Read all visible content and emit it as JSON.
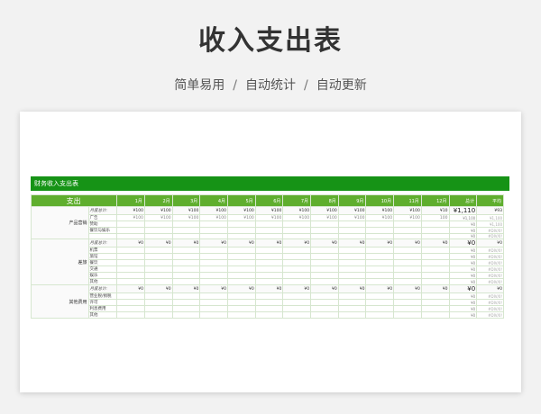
{
  "title": "收入支出表",
  "subtitle": [
    "简单易用",
    "自动统计",
    "自动更新"
  ],
  "separator": "/",
  "sheet": {
    "banner": "财务收入支出表",
    "header": {
      "main": "支出",
      "months": [
        "1月",
        "2月",
        "3月",
        "4月",
        "5月",
        "6月",
        "7月",
        "8月",
        "9月",
        "10月",
        "11月",
        "12月"
      ],
      "total": "总计",
      "avg": "平均"
    },
    "groups": [
      {
        "name": "产品营销",
        "summary": {
          "label": "月度总计:",
          "months": [
            "¥100",
            "¥100",
            "¥100",
            "¥100",
            "¥100",
            "¥100",
            "¥100",
            "¥100",
            "¥100",
            "¥100",
            "¥100",
            "¥10"
          ],
          "total": "¥1,110",
          "avg": "¥93"
        },
        "items": [
          {
            "label": "广告",
            "months": [
              "¥100",
              "¥100",
              "¥100",
              "¥100",
              "¥100",
              "¥100",
              "¥100",
              "¥100",
              "¥100",
              "¥100",
              "¥100",
              "100"
            ],
            "total": "¥1,100",
            "avg": "¥1,100"
          },
          {
            "label": "赞助",
            "months": [
              "",
              "",
              "",
              "",
              "",
              "",
              "",
              "",
              "",
              "",
              "",
              ""
            ],
            "total": "¥0",
            "avg": "¥1,100"
          },
          {
            "label": "餐饮与娱乐",
            "months": [
              "",
              "",
              "",
              "",
              "",
              "",
              "",
              "",
              "",
              "",
              "",
              ""
            ],
            "total": "¥0",
            "avg": "#DIV/0!"
          },
          {
            "label": "",
            "months": [
              "",
              "",
              "",
              "",
              "",
              "",
              "",
              "",
              "",
              "",
              "",
              ""
            ],
            "total": "¥0",
            "avg": "#DIV/0!"
          }
        ]
      },
      {
        "name": "差旅",
        "summary": {
          "label": "月度总计:",
          "months": [
            "¥0",
            "¥0",
            "¥0",
            "¥0",
            "¥0",
            "¥0",
            "¥0",
            "¥0",
            "¥0",
            "¥0",
            "¥0",
            "¥0"
          ],
          "total": "¥0",
          "avg": "¥0"
        },
        "items": [
          {
            "label": "机票",
            "months": [
              "",
              "",
              "",
              "",
              "",
              "",
              "",
              "",
              "",
              "",
              "",
              ""
            ],
            "total": "¥0",
            "avg": "#DIV/0!"
          },
          {
            "label": "旅馆",
            "months": [
              "",
              "",
              "",
              "",
              "",
              "",
              "",
              "",
              "",
              "",
              "",
              ""
            ],
            "total": "¥0",
            "avg": "#DIV/0!"
          },
          {
            "label": "餐饮",
            "months": [
              "",
              "",
              "",
              "",
              "",
              "",
              "",
              "",
              "",
              "",
              "",
              ""
            ],
            "total": "¥0",
            "avg": "#DIV/0!"
          },
          {
            "label": "交通",
            "months": [
              "",
              "",
              "",
              "",
              "",
              "",
              "",
              "",
              "",
              "",
              "",
              ""
            ],
            "total": "¥0",
            "avg": "#DIV/0!"
          },
          {
            "label": "娱乐",
            "months": [
              "",
              "",
              "",
              "",
              "",
              "",
              "",
              "",
              "",
              "",
              "",
              ""
            ],
            "total": "¥0",
            "avg": "#DIV/0!"
          },
          {
            "label": "其他",
            "months": [
              "",
              "",
              "",
              "",
              "",
              "",
              "",
              "",
              "",
              "",
              "",
              ""
            ],
            "total": "¥0",
            "avg": "#DIV/0!"
          }
        ]
      },
      {
        "name": "其他费用",
        "summary": {
          "label": "月度总计:",
          "months": [
            "¥0",
            "¥0",
            "¥0",
            "¥0",
            "¥0",
            "¥0",
            "¥0",
            "¥0",
            "¥0",
            "¥0",
            "¥0",
            "¥0"
          ],
          "total": "¥0",
          "avg": "¥0"
        },
        "items": [
          {
            "label": "营业税/捐税",
            "months": [
              "",
              "",
              "",
              "",
              "",
              "",
              "",
              "",
              "",
              "",
              "",
              ""
            ],
            "total": "¥0",
            "avg": "#DIV/0!"
          },
          {
            "label": "许可",
            "months": [
              "",
              "",
              "",
              "",
              "",
              "",
              "",
              "",
              "",
              "",
              "",
              ""
            ],
            "total": "¥0",
            "avg": "#DIV/0!"
          },
          {
            "label": "利息费用",
            "months": [
              "",
              "",
              "",
              "",
              "",
              "",
              "",
              "",
              "",
              "",
              "",
              ""
            ],
            "total": "¥0",
            "avg": "#DIV/0!"
          },
          {
            "label": "其他",
            "months": [
              "",
              "",
              "",
              "",
              "",
              "",
              "",
              "",
              "",
              "",
              "",
              ""
            ],
            "total": "¥0",
            "avg": "#DIV/0!"
          }
        ]
      }
    ]
  }
}
